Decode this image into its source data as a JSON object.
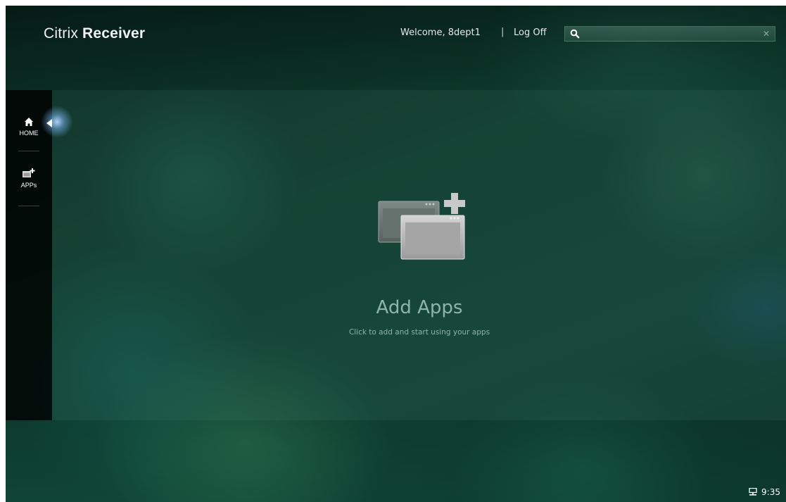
{
  "header": {
    "brand_light": "Citrix",
    "brand_bold": "Receiver",
    "welcome": "Welcome, 8dept1",
    "separator": "|",
    "logoff_label": "Log Off",
    "search": {
      "value": "",
      "placeholder": "",
      "icon": "search-icon",
      "clear_icon": "close-icon"
    }
  },
  "sidebar": {
    "items": [
      {
        "label": "HOME",
        "icon": "home-icon",
        "active": true
      },
      {
        "label": "APPs",
        "icon": "add-apps-icon",
        "active": false
      }
    ]
  },
  "main": {
    "empty_state": {
      "icon": "add-apps-icon",
      "title": "Add Apps",
      "subtitle": "Click to add and start using your apps"
    }
  },
  "status": {
    "time": "9:35",
    "icon": "network-icon"
  },
  "colors": {
    "accent_text": "#8fb3ad",
    "active_glow": "#9cc8f5",
    "sidebar_bg": "#000000"
  }
}
